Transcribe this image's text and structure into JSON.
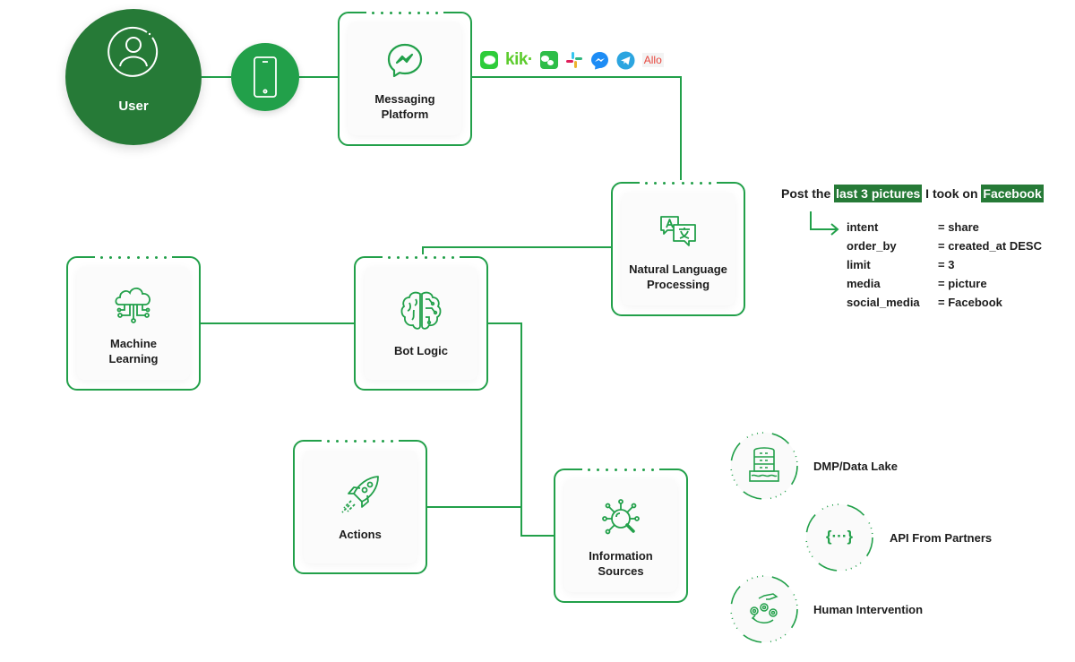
{
  "colors": {
    "dark_green": "#267a37",
    "green": "#22a04a",
    "text": "#1d1d1d"
  },
  "user": {
    "label": "User",
    "icon": "user-icon"
  },
  "device": {
    "icon": "smartphone-icon"
  },
  "nodes": {
    "messaging": {
      "label_line1": "Messaging",
      "label_line2": "Platform",
      "icon": "messenger-icon"
    },
    "nlp": {
      "label_line1": "Natural Language",
      "label_line2": "Processing",
      "icon": "translate-icon"
    },
    "ml": {
      "label_line1": "Machine",
      "label_line2": "Learning",
      "icon": "cloud-network-icon"
    },
    "bot": {
      "label_line1": "Bot Logic",
      "icon": "brain-icon"
    },
    "actions": {
      "label_line1": "Actions",
      "icon": "rocket-icon"
    },
    "info": {
      "label_line1": "Information",
      "label_line2": "Sources",
      "icon": "search-network-icon"
    }
  },
  "messaging_apps": [
    {
      "name": "LINE",
      "icon": "line-icon"
    },
    {
      "name": "kik",
      "icon": "kik-icon",
      "text": "kik·"
    },
    {
      "name": "WeChat",
      "icon": "wechat-icon"
    },
    {
      "name": "Slack",
      "icon": "slack-icon"
    },
    {
      "name": "Messenger",
      "icon": "messenger-app-icon"
    },
    {
      "name": "Telegram",
      "icon": "telegram-icon"
    },
    {
      "name": "Allo",
      "icon": "allo-icon",
      "text": "Allo"
    }
  ],
  "nlp_example": {
    "sentence_part1": "Post the ",
    "highlight1": "last 3 pictures",
    "sentence_part2": " I took on ",
    "highlight2": "Facebook",
    "params": [
      {
        "key": "intent",
        "value": "= share"
      },
      {
        "key": "order_by",
        "value": "= created_at DESC"
      },
      {
        "key": "limit",
        "value": "= 3"
      },
      {
        "key": "media",
        "value": "= picture"
      },
      {
        "key": "social_media",
        "value": "= Facebook"
      }
    ]
  },
  "sources": [
    {
      "label": "DMP/Data Lake",
      "icon": "database-icon"
    },
    {
      "label": "API From Partners",
      "icon": "code-braces-icon",
      "glyph": "{···}"
    },
    {
      "label": "Human Intervention",
      "icon": "hand-gears-icon"
    }
  ]
}
